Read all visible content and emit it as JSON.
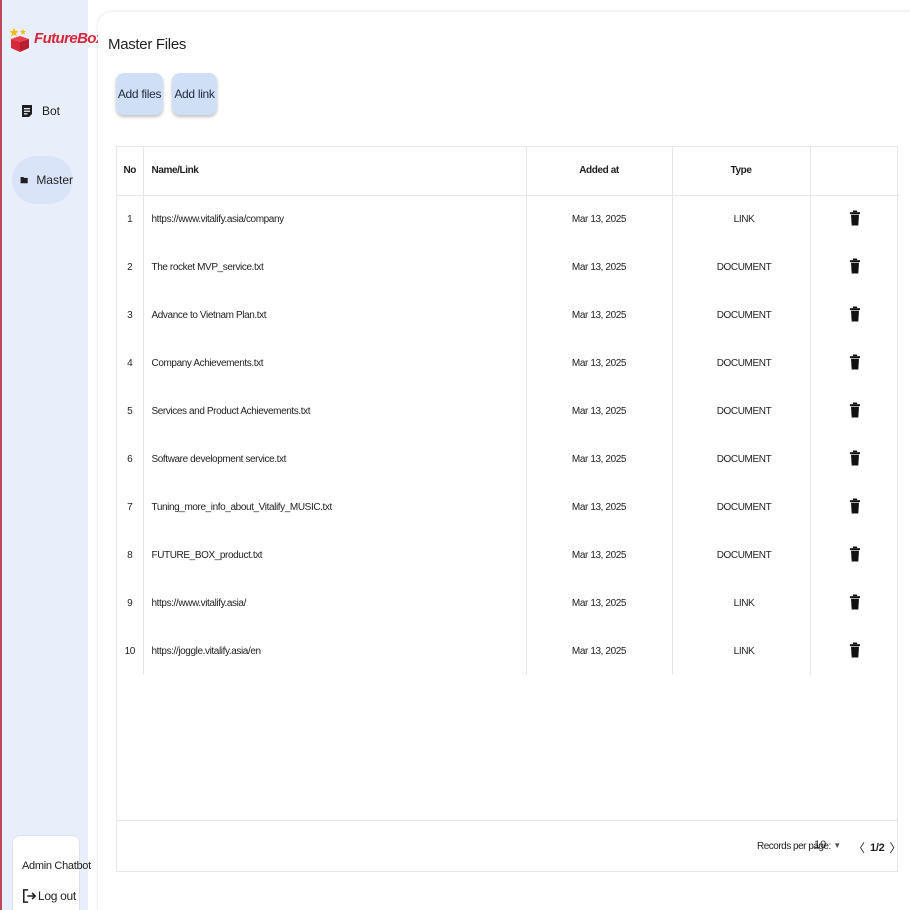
{
  "app": {
    "brand": "FutureBox",
    "accent_color": "#d6283b"
  },
  "sidebar": {
    "items": [
      {
        "label": "Bot",
        "icon": "document-list-icon",
        "active": false
      },
      {
        "label": "Master",
        "icon": "folder-icon",
        "active": true
      }
    ],
    "account_name": "Admin Chatbot",
    "logout_label": "Log out"
  },
  "main": {
    "title": "Master Files",
    "buttons": {
      "add_files": "Add files",
      "add_link": "Add link"
    },
    "table": {
      "headers": {
        "no": "No",
        "name": "Name/Link",
        "added": "Added at",
        "type": "Type"
      },
      "rows": [
        {
          "no": "1",
          "name": "https://www.vitalify.asia/company",
          "added": "Mar 13, 2025",
          "type": "LINK"
        },
        {
          "no": "2",
          "name": "The rocket MVP_service.txt",
          "added": "Mar 13, 2025",
          "type": "DOCUMENT"
        },
        {
          "no": "3",
          "name": "Advance to Vietnam Plan.txt",
          "added": "Mar 13, 2025",
          "type": "DOCUMENT"
        },
        {
          "no": "4",
          "name": "Company Achievements.txt",
          "added": "Mar 13, 2025",
          "type": "DOCUMENT"
        },
        {
          "no": "5",
          "name": "Services and Product Achievements.txt",
          "added": "Mar 13, 2025",
          "type": "DOCUMENT"
        },
        {
          "no": "6",
          "name": "Software development service.txt",
          "added": "Mar 13, 2025",
          "type": "DOCUMENT"
        },
        {
          "no": "7",
          "name": "Tuning_more_info_about_Vitalify_MUSIC.txt",
          "added": "Mar 13, 2025",
          "type": "DOCUMENT"
        },
        {
          "no": "8",
          "name": "FUTURE_BOX_product.txt",
          "added": "Mar 13, 2025",
          "type": "DOCUMENT"
        },
        {
          "no": "9",
          "name": "https://www.vitalify.asia/",
          "added": "Mar 13, 2025",
          "type": "LINK"
        },
        {
          "no": "10",
          "name": "https://joggle.vitalify.asia/en",
          "added": "Mar 13, 2025",
          "type": "LINK"
        }
      ]
    },
    "footer": {
      "records_per_page_label": "Records per page:",
      "records_per_page_value": "10",
      "page_indicator": "1/2"
    }
  }
}
